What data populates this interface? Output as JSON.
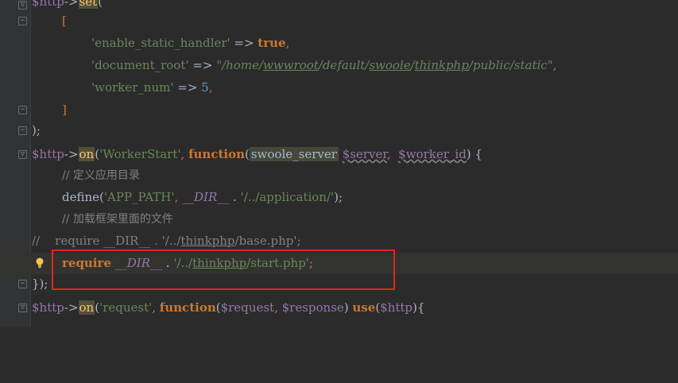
{
  "editor": {
    "line0": {
      "var": "$http",
      "arrow": "->",
      "method": "set",
      "paren": "("
    },
    "line1": {
      "bracket": "["
    },
    "line2": {
      "key": "'enable_static_handler'",
      "arrow": " => ",
      "value": "true",
      "comma": ","
    },
    "line3": {
      "key": "'document_root'",
      "arrow": " => ",
      "p1": "\"/home/",
      "p2": "wwwroot",
      "p3": "/default/",
      "p4": "swoole",
      "p5": "/",
      "p6": "thinkphp",
      "p7": "/public/static\"",
      "comma": ","
    },
    "line4": {
      "key": "'worker_num'",
      "arrow": " => ",
      "value": "5",
      "comma": ","
    },
    "line5": {
      "bracket": "]"
    },
    "line6": {
      "text": ");"
    },
    "line7": {
      "var": "$http",
      "arrow": "->",
      "method": "on",
      "open": "(",
      "event": "'WorkerStart'",
      "sep": ", ",
      "fn": "function",
      "popen": "(",
      "type": "swoole_server",
      "sp": " ",
      "arg1": "$server",
      "sep2": ",  ",
      "arg2": "$worker_id",
      "close": ") {"
    },
    "line8": {
      "comment": "// 定义应用目录"
    },
    "line9": {
      "fn": "define",
      "open": "(",
      "name": "'APP_PATH'",
      "sep": ", ",
      "magic": "__DIR__",
      "dot": " . ",
      "path": "'/../application/'",
      "close": ");"
    },
    "line10": {
      "comment": "// 加载框架里面的文件"
    },
    "line11": {
      "c1": "//    require __DIR__ . '/../",
      "c2": "thinkphp",
      "c3": "/base.php';"
    },
    "line12": {
      "kw": "require",
      "sp": " ",
      "magic": "__DIR__",
      "dot": " . ",
      "p1": "'/../",
      "p2": "thinkphp",
      "p3": "/start.php'",
      "end": ";"
    },
    "line13": {
      "text": "});"
    },
    "line14": {
      "var": "$http",
      "arrow": "->",
      "method": "on",
      "open": "(",
      "event": "'request'",
      "sep": ", ",
      "fn": "function",
      "popen": "(",
      "arg1": "$request",
      "sep2": ", ",
      "arg2": "$response",
      "pclose": ") ",
      "use": "use",
      "uopen": "(",
      "arg3": "$http",
      "close": "){"
    }
  },
  "colors": {
    "background": "#2b2b2b",
    "keyword": "#cc7832",
    "string": "#6a8759",
    "variable": "#9876aa",
    "number": "#6897bb",
    "comment": "#808080",
    "highlight_box": "#e1261c"
  },
  "icons": [
    "fold-marker-icon",
    "lightbulb-icon"
  ]
}
